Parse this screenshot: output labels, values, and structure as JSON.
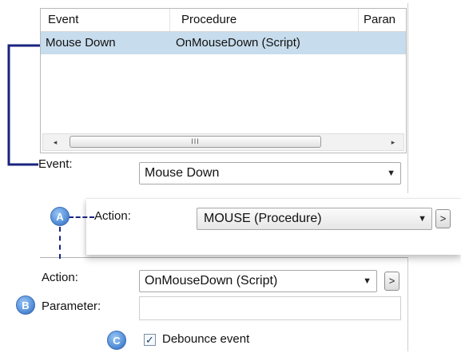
{
  "event_list": {
    "columns": [
      "Event",
      "Procedure",
      "Paran"
    ],
    "rows": [
      {
        "event": "Mouse Down",
        "procedure": "OnMouseDown (Script)",
        "parameter": ""
      }
    ],
    "scrollbar": {
      "grip": "III",
      "left_arrow": "◂",
      "right_arrow": "▸"
    }
  },
  "event_field": {
    "label": "Event:",
    "value": "Mouse Down"
  },
  "callout_action": {
    "badge": "A",
    "label": "Action:",
    "value": "MOUSE (Procedure)",
    "more_label": ">"
  },
  "action_field": {
    "label": "Action:",
    "value": "OnMouseDown (Script)",
    "more_label": ">"
  },
  "parameter_field": {
    "badge": "B",
    "label": "Parameter:",
    "value": ""
  },
  "debounce": {
    "badge": "C",
    "label": "Debounce event",
    "checked": true,
    "check_glyph": "✓"
  },
  "icons": {
    "dropdown": "▼"
  },
  "colors": {
    "connector": "#1a237e",
    "selection": "#c7dcec",
    "badge": "#5c95db"
  }
}
